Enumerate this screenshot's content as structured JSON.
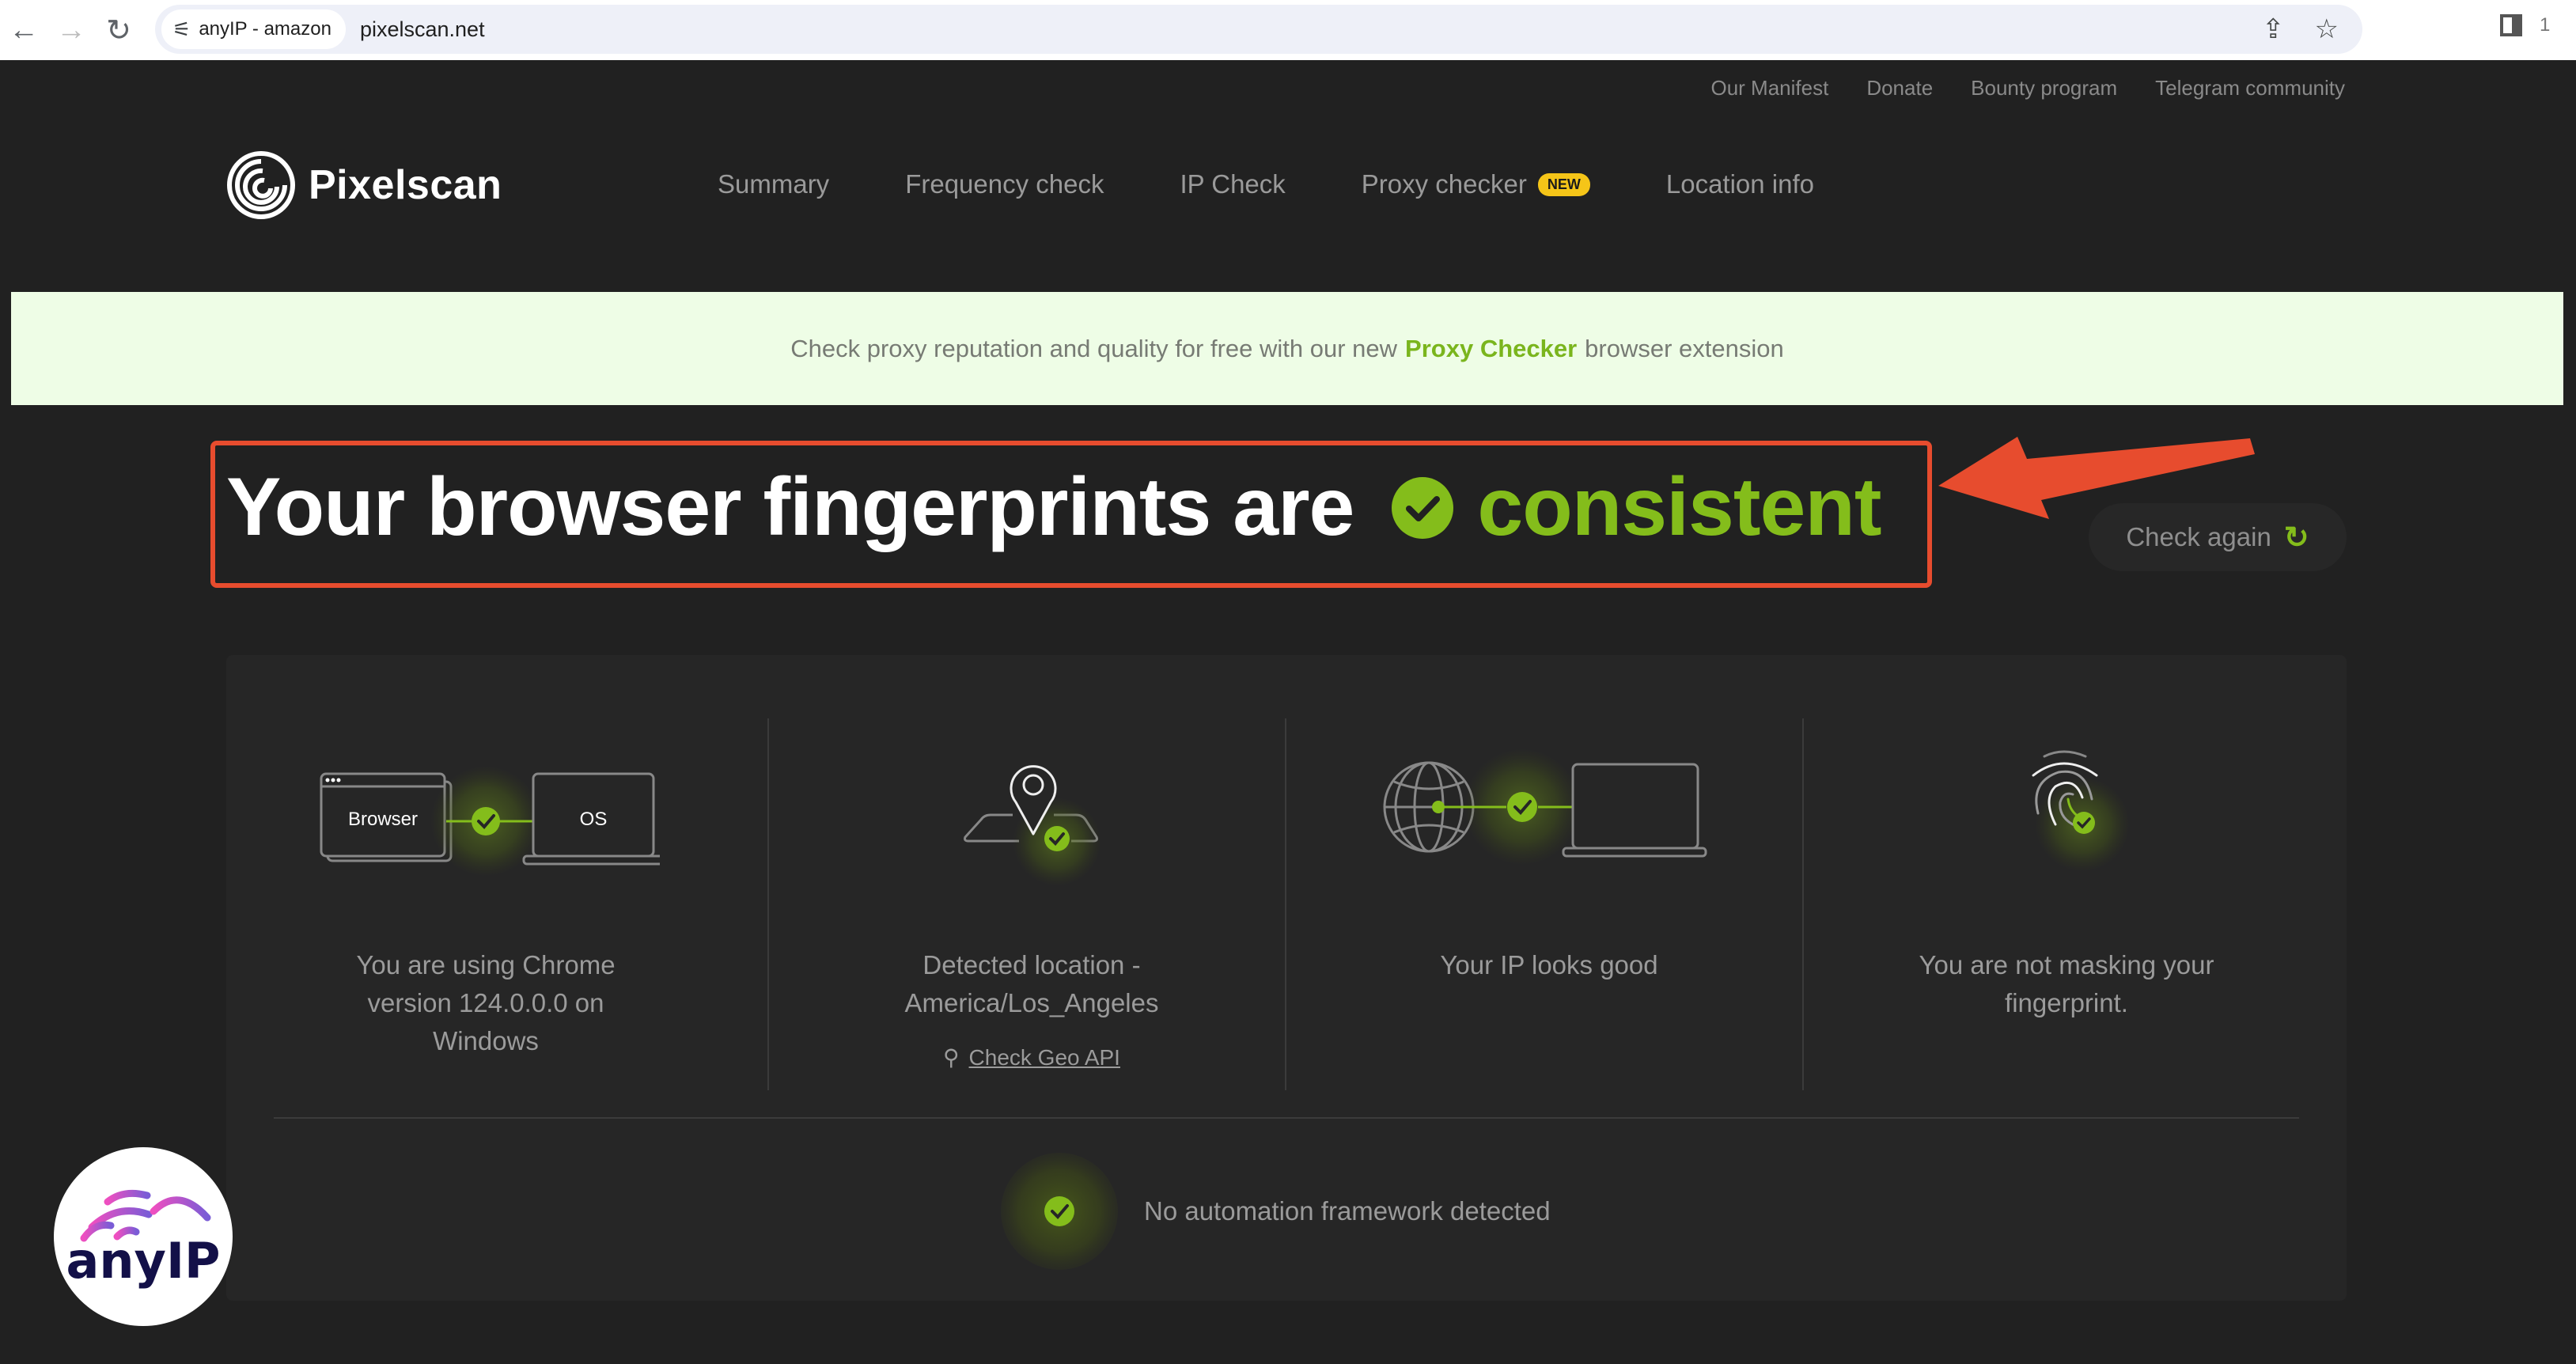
{
  "browser": {
    "back_icon": "arrow-left-icon",
    "forward_icon": "arrow-right-icon",
    "reload_icon": "reload-icon",
    "site_chip_label": "anyIP - amazon",
    "url": "pixelscan.net",
    "tab_count": "1"
  },
  "top_links": [
    "Our Manifest",
    "Donate",
    "Bounty program",
    "Telegram community"
  ],
  "header": {
    "brand": "Pixelscan",
    "nav": [
      {
        "label": "Summary"
      },
      {
        "label": "Frequency check"
      },
      {
        "label": "IP Check"
      },
      {
        "label": "Proxy checker",
        "badge": "NEW"
      },
      {
        "label": "Location info"
      }
    ]
  },
  "banner": {
    "prefix": "Check proxy reputation and quality for free with our new",
    "highlight": "Proxy Checker",
    "suffix": "browser extension"
  },
  "result": {
    "headline_prefix": "Your browser fingerprints are",
    "status": "consistent",
    "check_again_label": "Check again",
    "accent_color": "#84bd1b",
    "annotation_color": "#e74c2e"
  },
  "checks": [
    {
      "id": "browser-os",
      "illustration_labels": [
        "Browser",
        "OS"
      ],
      "text": "You are using Chrome version 124.0.0.0 on Windows"
    },
    {
      "id": "location",
      "text": "Detected location - America/Los_Angeles",
      "link": "Check Geo API"
    },
    {
      "id": "ip",
      "text": "Your IP looks good"
    },
    {
      "id": "fingerprint-masking",
      "text": "You are not masking your fingerprint."
    }
  ],
  "automation": {
    "text": "No automation framework detected"
  },
  "watermark": {
    "label": "anyIP"
  }
}
